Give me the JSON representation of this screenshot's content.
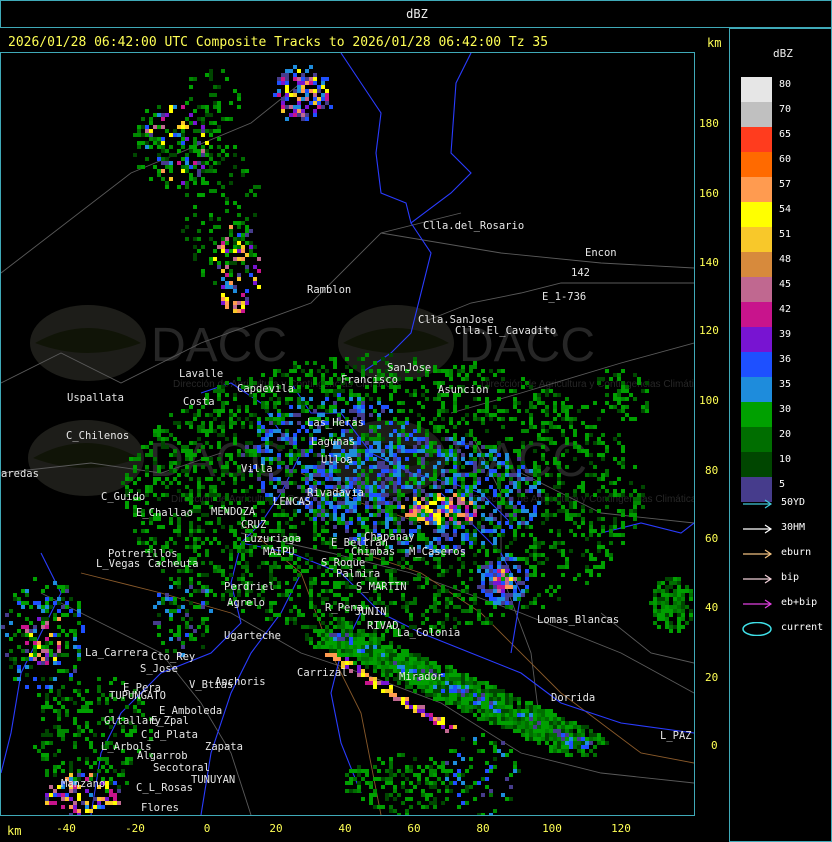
{
  "window": {
    "title": "dBZ"
  },
  "header": {
    "text": "2026/01/28 06:42:00 UTC Composite Tracks to 2026/01/28 06:42:00 Tz 35",
    "km_top": "km",
    "km_bottom": "km"
  },
  "axes": {
    "y_ticks": [
      "180",
      "160",
      "140",
      "120",
      "100",
      "80",
      "60",
      "40",
      "20",
      "0"
    ],
    "x_ticks": [
      "-40",
      "-20",
      "0",
      "20",
      "40",
      "60",
      "80",
      "100",
      "120"
    ]
  },
  "legend": {
    "title": "dBZ",
    "scale": [
      {
        "label": "80",
        "color": "#e6e6e6"
      },
      {
        "label": "70",
        "color": "#c0c0c0"
      },
      {
        "label": "65",
        "color": "#ff3c1e"
      },
      {
        "label": "60",
        "color": "#ff6a00"
      },
      {
        "label": "57",
        "color": "#ff9b50"
      },
      {
        "label": "54",
        "color": "#ffff00"
      },
      {
        "label": "51",
        "color": "#f8c82a"
      },
      {
        "label": "48",
        "color": "#d78a3c"
      },
      {
        "label": "45",
        "color": "#c06890"
      },
      {
        "label": "42",
        "color": "#c8148c"
      },
      {
        "label": "39",
        "color": "#7814d2"
      },
      {
        "label": "36",
        "color": "#1e50ff"
      },
      {
        "label": "35",
        "color": "#1e8cdc"
      },
      {
        "label": "30",
        "color": "#00a000"
      },
      {
        "label": "20",
        "color": "#006e00"
      },
      {
        "label": "10",
        "color": "#004600"
      },
      {
        "label": "5",
        "color": "#463c8c"
      }
    ],
    "tracks": [
      {
        "label": "50YD",
        "color": "#40c8d8"
      },
      {
        "label": "30HM",
        "color": "#ffffff"
      },
      {
        "label": "eburn",
        "color": "#f0c080"
      },
      {
        "label": "bip",
        "color": "#f0d0d8"
      },
      {
        "label": "eb+bip",
        "color": "#e040e0"
      },
      {
        "label": "current",
        "color": "#40e0e8"
      }
    ]
  },
  "map": {
    "watermark": {
      "brand": "DACC",
      "tagline": "Dirección de Agricultura y Contingencias Climáticas"
    },
    "places": [
      "Clla.del_Rosario",
      "Encon",
      "142",
      "E_1-736",
      "Ramblon",
      "Clla.SanJose",
      "Clla.El_Cavadito",
      "Uspallata",
      "C_Chilenos",
      "aredas",
      "Lavalle",
      "Costa",
      "Capdevila",
      "Francisco",
      "SanJose",
      "Asuncion",
      "Las_Heras",
      "Lagunas",
      "Ulloa",
      "Rivadavia",
      "Villa",
      "LENCAS",
      "C_Guido",
      "E_Challao",
      "MENDOZA",
      "CRUZ",
      "Luzuriaga",
      "E_Beltran",
      "Chimbas",
      "Chapanay",
      "M_Caseros",
      "Potrerillos",
      "Cacheuta",
      "L_Vegas",
      "MAIPU",
      "S_Roque",
      "Palmira",
      "Perdriel",
      "S_MARTIN",
      "Agrelo",
      "R_Pena",
      "JUNIN",
      "RIVAD",
      "La_Colonia",
      "Ugarteche",
      "Lomas_Blancas",
      "La_Carrera",
      "Cto_Rey",
      "S_Jose",
      "Carrizal",
      "E_Pera",
      "V_Btias",
      "TUPUNGATO",
      "Anchoris",
      "Mirador",
      "Dorrida",
      "Gltallary",
      "E_Zpal",
      "E_Amboleda",
      "C_d_Plata",
      "L_Arbols",
      "Zapata",
      "Algarrob",
      "Secotoral",
      "TUNUYAN",
      "C_L_Rosas",
      "Manzano",
      "Flores",
      "L_PAZ"
    ]
  }
}
